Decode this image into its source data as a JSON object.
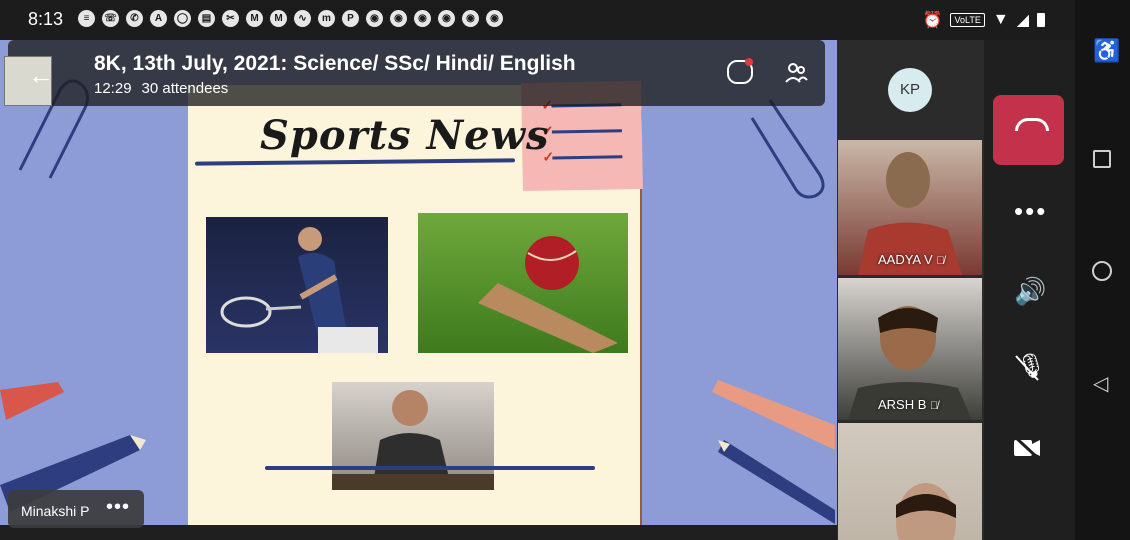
{
  "status_bar": {
    "time": "8:13",
    "notification_icons": [
      "message-icon",
      "whatsapp-icon",
      "phone-icon",
      "a-icon",
      "o-icon",
      "bank-icon",
      "scissor-icon",
      "gmail-icon",
      "gmail-icon",
      "swirl-icon",
      "m-icon",
      "paytm-icon",
      "chrome-icon",
      "chrome-icon",
      "chrome-icon",
      "chrome-icon",
      "chrome-icon",
      "chrome-icon"
    ],
    "volte": "VoLTE"
  },
  "meeting": {
    "title": "8K, 13th July, 2021: Science/ SSc/ Hindi/ English",
    "duration": "12:29",
    "attendees": "30 attendees"
  },
  "slide": {
    "title": "Sports News"
  },
  "presenter": {
    "name": "Minakshi P",
    "more": "•••"
  },
  "participants": {
    "avatar_initials": "KP",
    "tiles": [
      {
        "name": "AADYA V"
      },
      {
        "name": "ARSH B"
      },
      {
        "name": ""
      }
    ]
  },
  "controls": {
    "more": "•••"
  },
  "colors": {
    "hangup": "#c4314b",
    "slide_bg": "#8d9bd6",
    "paper": "#fdf4dc",
    "note": "#f5b8b5"
  }
}
